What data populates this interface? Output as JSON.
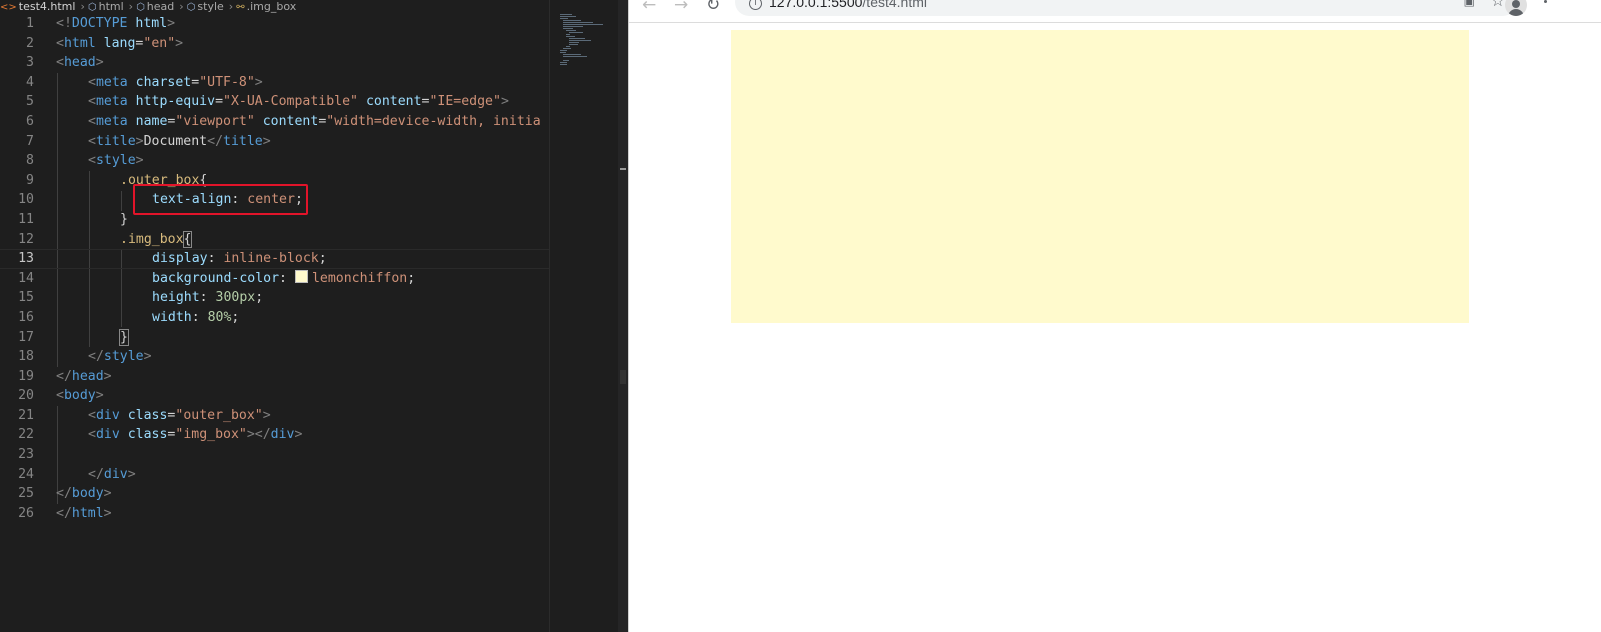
{
  "editor": {
    "breadcrumb": {
      "file": "test4.html",
      "items": [
        "html",
        "head",
        "style",
        ".img_box"
      ]
    },
    "active_line": 13,
    "lines": [
      {
        "n": "1"
      },
      {
        "n": "2"
      },
      {
        "n": "3"
      },
      {
        "n": "4"
      },
      {
        "n": "5"
      },
      {
        "n": "6"
      },
      {
        "n": "7"
      },
      {
        "n": "8"
      },
      {
        "n": "9"
      },
      {
        "n": "10"
      },
      {
        "n": "11"
      },
      {
        "n": "12"
      },
      {
        "n": "13"
      },
      {
        "n": "14"
      },
      {
        "n": "15"
      },
      {
        "n": "16"
      },
      {
        "n": "17"
      },
      {
        "n": "18"
      },
      {
        "n": "19"
      },
      {
        "n": "20"
      },
      {
        "n": "21"
      },
      {
        "n": "22"
      },
      {
        "n": "23"
      },
      {
        "n": "24"
      },
      {
        "n": "25"
      },
      {
        "n": "26"
      }
    ],
    "code": {
      "l1": {
        "a": "<!",
        "b": "DOCTYPE",
        "c": " html",
        "d": ">"
      },
      "l2": {
        "a": "<",
        "b": "html",
        "c": " lang",
        "d": "=",
        "e": "\"en\"",
        "f": ">"
      },
      "l3": {
        "a": "<",
        "b": "head",
        "c": ">"
      },
      "l4": {
        "a": "<",
        "b": "meta",
        "c": " charset",
        "d": "=",
        "e": "\"UTF-8\"",
        "f": ">"
      },
      "l5": {
        "a": "<",
        "b": "meta",
        "c": " http-equiv",
        "d": "=",
        "e": "\"X-UA-Compatible\"",
        "f": " content",
        "g": "=",
        "h": "\"IE=edge\"",
        "i": ">"
      },
      "l6": {
        "a": "<",
        "b": "meta",
        "c": " name",
        "d": "=",
        "e": "\"viewport\"",
        "f": " content",
        "g": "=",
        "h": "\"width=device-width, initia"
      },
      "l7": {
        "a": "<",
        "b": "title",
        "c": ">",
        "d": "Document",
        "e": "</",
        "f": "title",
        "g": ">"
      },
      "l8": {
        "a": "<",
        "b": "style",
        "c": ">"
      },
      "l9": {
        "a": ".outer_box",
        "b": "{"
      },
      "l10": {
        "a": "text-align",
        "b": ": ",
        "c": "center",
        "d": ";"
      },
      "l11": {
        "a": "}"
      },
      "l12": {
        "a": ".img_box",
        "b": "{"
      },
      "l13": {
        "a": "display",
        "b": ": ",
        "c": "inline-block",
        "d": ";"
      },
      "l14": {
        "a": "background-color",
        "b": ": ",
        "c": "lemonchiffon",
        "d": ";"
      },
      "l15": {
        "a": "height",
        "b": ": ",
        "c": "300px",
        "d": ";"
      },
      "l16": {
        "a": "width",
        "b": ": ",
        "c": "80%",
        "d": ";"
      },
      "l17": {
        "a": "}"
      },
      "l18": {
        "a": "</",
        "b": "style",
        "c": ">"
      },
      "l19": {
        "a": "</",
        "b": "head",
        "c": ">"
      },
      "l20": {
        "a": "<",
        "b": "body",
        "c": ">"
      },
      "l21": {
        "a": "<",
        "b": "div",
        "c": " class",
        "d": "=",
        "e": "\"outer_box\"",
        "f": ">"
      },
      "l22": {
        "a": "<",
        "b": "div",
        "c": " class",
        "d": "=",
        "e": "\"img_box\"",
        "f": "></",
        "g": "div",
        "h": ">"
      },
      "l24": {
        "a": "</",
        "b": "div",
        "c": ">"
      },
      "l25": {
        "a": "</",
        "b": "body",
        "c": ">"
      },
      "l26": {
        "a": "</",
        "b": "html",
        "c": ">"
      }
    },
    "colors": {
      "background": "#1e1e1e",
      "tag": "#569cd6",
      "attribute": "#9cdcfe",
      "string": "#ce9178",
      "selector": "#d7ba7d",
      "number": "#b5cea8",
      "highlight_box": "#e2142a",
      "swatch": "#fffacd"
    },
    "icons": [
      "html-file-icon",
      "cube-icon",
      "selector-icon"
    ]
  },
  "browser": {
    "url_host": "127.0.0.1:5500",
    "url_path": "/test4.html",
    "icons": [
      "back-arrow-icon",
      "forward-arrow-icon",
      "reload-icon",
      "info-icon",
      "translate-icon",
      "star-icon",
      "profile-icon",
      "menu-icon"
    ],
    "img_box_color": "#fffacd"
  }
}
